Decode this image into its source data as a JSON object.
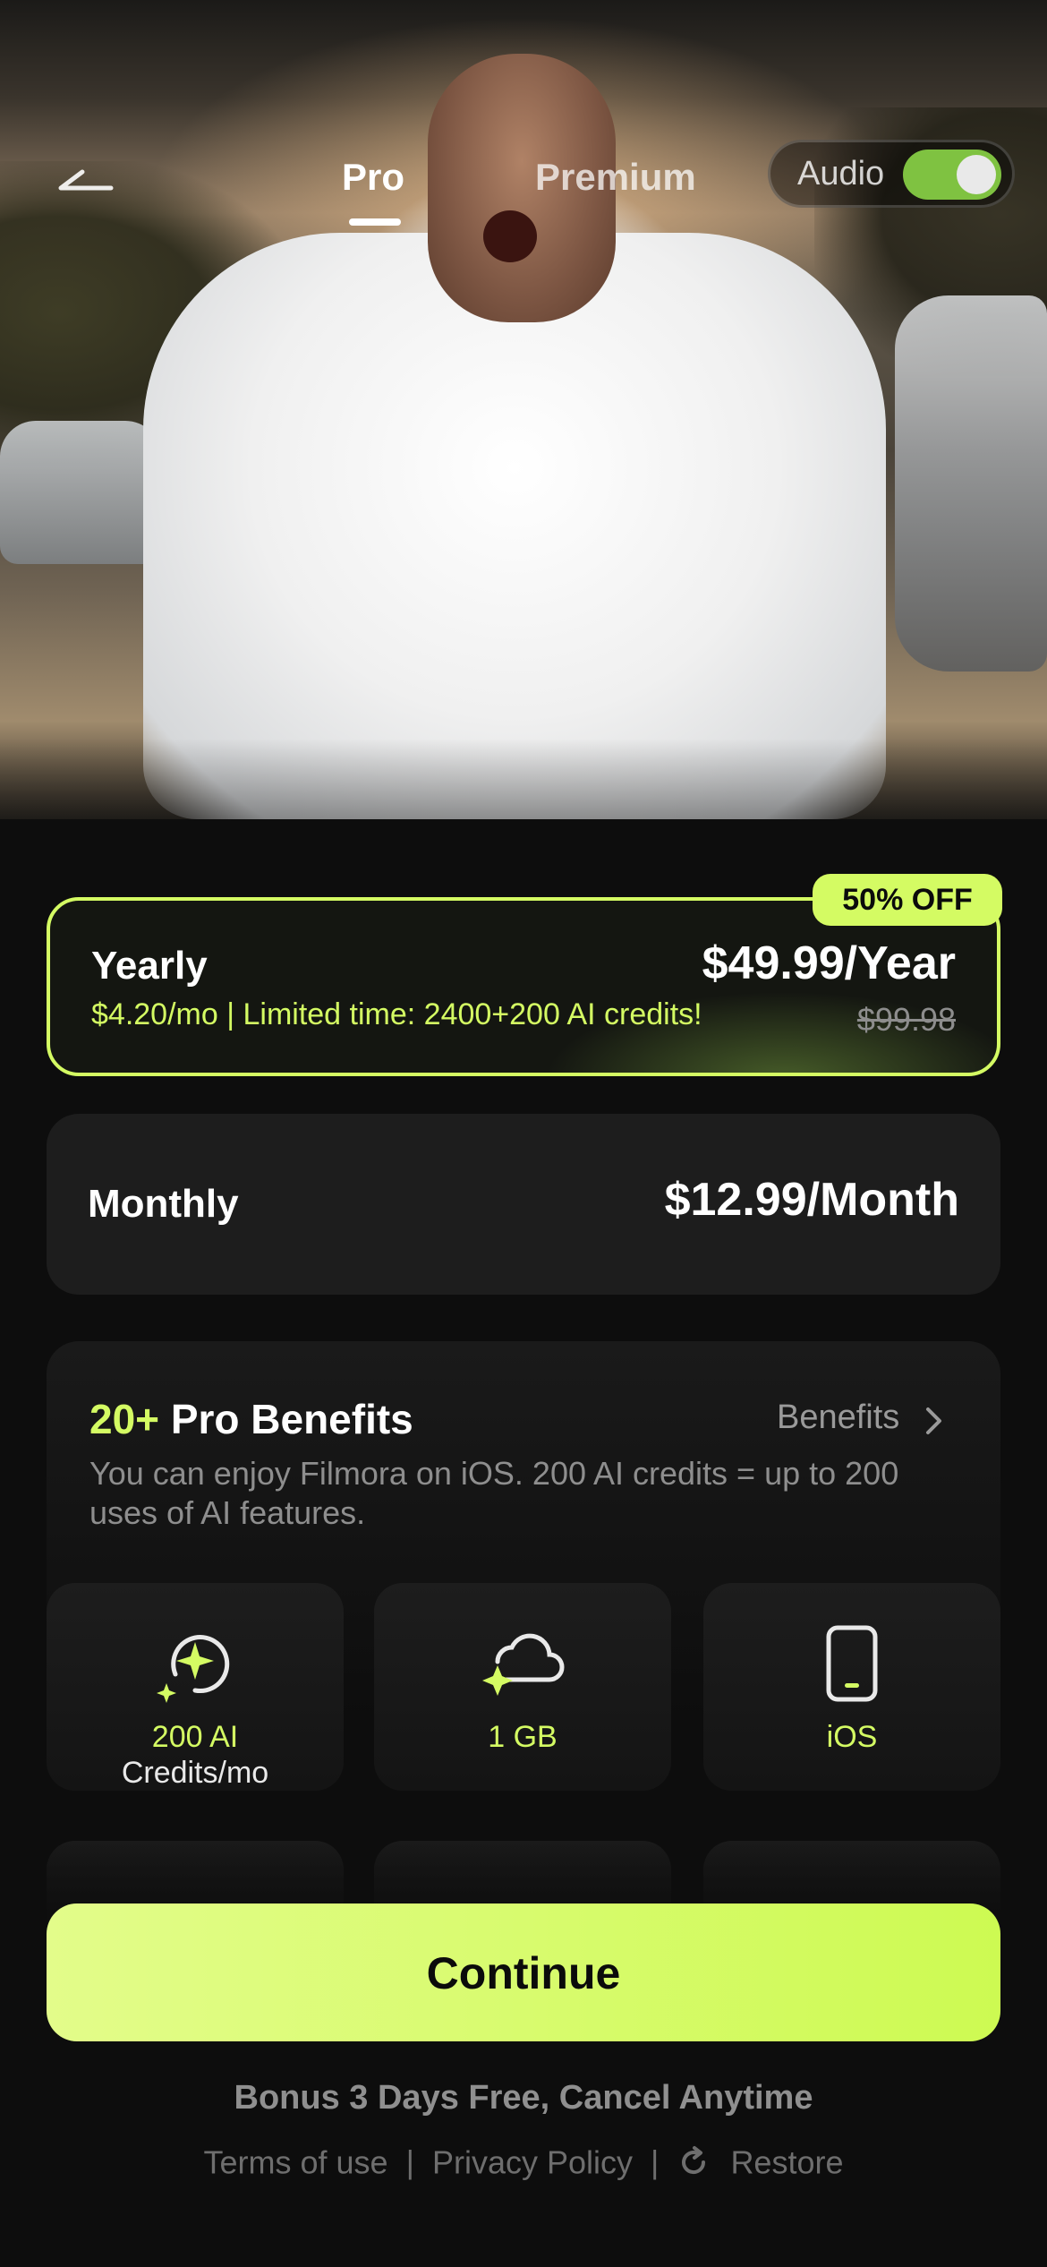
{
  "header": {
    "tabs": [
      {
        "label": "Pro",
        "active": true
      },
      {
        "label": "Premium",
        "active": false
      }
    ],
    "audio_label": "Audio",
    "audio_on": true
  },
  "plans": {
    "yearly": {
      "name": "Yearly",
      "price": "$49.99/Year",
      "subtitle": "$4.20/mo | Limited time: 2400+200 AI credits!",
      "original_price": "$99.98",
      "badge": "50% OFF",
      "selected": true
    },
    "monthly": {
      "name": "Monthly",
      "price": "$12.99/Month",
      "selected": false
    }
  },
  "benefits": {
    "title_accent": "20+",
    "title_rest": "Pro Benefits",
    "link": "Benefits",
    "description": "You can enjoy Filmora on iOS. 200 AI credits = up to 200 uses of AI features.",
    "tiles": [
      {
        "label_accent": "200 AI",
        "label_rest": "Credits/mo",
        "icon": "ai-credits-icon"
      },
      {
        "label_accent": "1 GB",
        "label_rest": "",
        "icon": "cloud-sparkle-icon"
      },
      {
        "label_accent": "iOS",
        "label_rest": "",
        "icon": "phone-icon"
      }
    ]
  },
  "cta": {
    "continue": "Continue",
    "bonus": "Bonus 3 Days Free, Cancel Anytime"
  },
  "footer": {
    "terms": "Terms of use",
    "privacy": "Privacy Policy",
    "restore": "Restore",
    "separator": "|"
  },
  "colors": {
    "accent": "#d4fb63",
    "background": "#0d0d0d",
    "card": "#1d1d1d",
    "muted": "#8e8e8e"
  }
}
